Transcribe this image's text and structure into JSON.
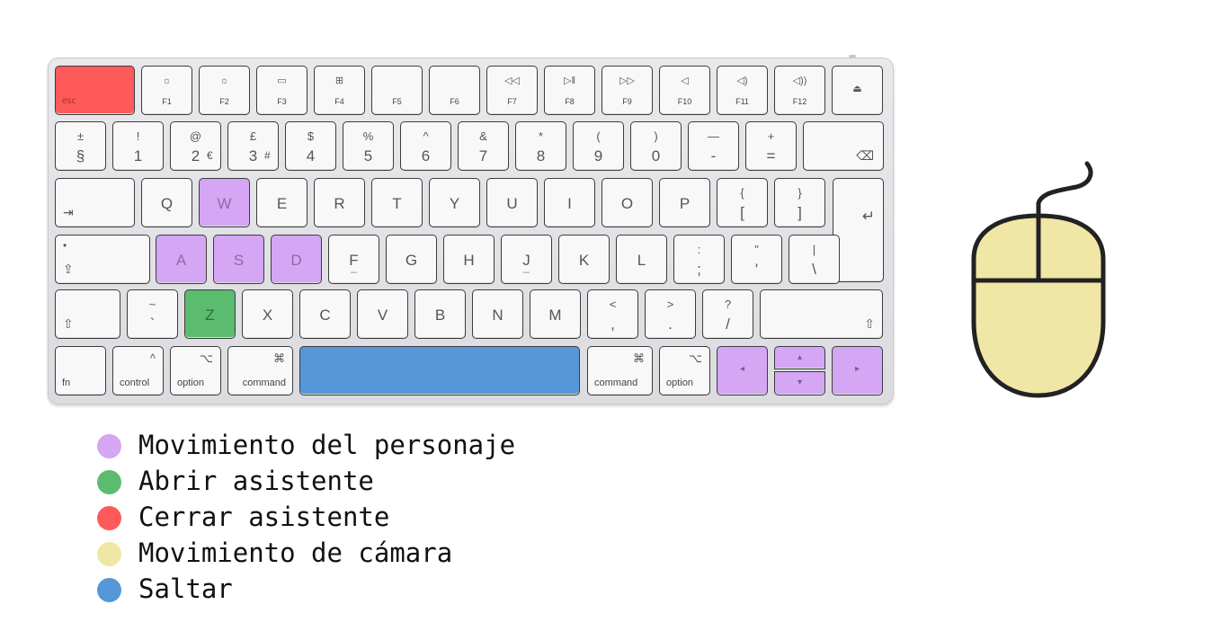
{
  "keyboard": {
    "rows": [
      [
        {
          "id": "esc",
          "main": "esc",
          "highlight": "red"
        },
        {
          "id": "f1",
          "icon": "☼",
          "sub": "F1"
        },
        {
          "id": "f2",
          "icon": "☼",
          "sub": "F2"
        },
        {
          "id": "f3",
          "icon": "▭",
          "sub": "F3"
        },
        {
          "id": "f4",
          "icon": "⊞",
          "sub": "F4"
        },
        {
          "id": "f5",
          "sub": "F5"
        },
        {
          "id": "f6",
          "sub": "F6"
        },
        {
          "id": "f7",
          "icon": "◁◁",
          "sub": "F7"
        },
        {
          "id": "f8",
          "icon": "▷‖",
          "sub": "F8"
        },
        {
          "id": "f9",
          "icon": "▷▷",
          "sub": "F9"
        },
        {
          "id": "f10",
          "icon": "◁",
          "sub": "F10"
        },
        {
          "id": "f11",
          "icon": "◁)",
          "sub": "F11"
        },
        {
          "id": "f12",
          "icon": "◁))",
          "sub": "F12"
        },
        {
          "id": "eject",
          "icon": "⏏"
        }
      ],
      [
        {
          "id": "section",
          "top": "±",
          "bottom": "§"
        },
        {
          "id": "1",
          "top": "!",
          "bottom": "1"
        },
        {
          "id": "2",
          "top": "@",
          "bottom": "2",
          "extra": "€"
        },
        {
          "id": "3",
          "top": "£",
          "bottom": "3",
          "extra": "#"
        },
        {
          "id": "4",
          "top": "$",
          "bottom": "4"
        },
        {
          "id": "5",
          "top": "%",
          "bottom": "5"
        },
        {
          "id": "6",
          "top": "^",
          "bottom": "6"
        },
        {
          "id": "7",
          "top": "&",
          "bottom": "7"
        },
        {
          "id": "8",
          "top": "*",
          "bottom": "8"
        },
        {
          "id": "9",
          "top": "(",
          "bottom": "9"
        },
        {
          "id": "0",
          "top": ")",
          "bottom": "0"
        },
        {
          "id": "minus",
          "top": "—",
          "bottom": "-"
        },
        {
          "id": "plus",
          "top": "+",
          "bottom": "="
        },
        {
          "id": "delete",
          "icon": "⌫"
        }
      ],
      [
        {
          "id": "tab",
          "icon": "⇥"
        },
        {
          "id": "q",
          "main": "Q"
        },
        {
          "id": "w",
          "main": "W",
          "highlight": "purple"
        },
        {
          "id": "e",
          "main": "E"
        },
        {
          "id": "r",
          "main": "R"
        },
        {
          "id": "t",
          "main": "T"
        },
        {
          "id": "y",
          "main": "Y"
        },
        {
          "id": "u",
          "main": "U"
        },
        {
          "id": "i",
          "main": "I"
        },
        {
          "id": "o",
          "main": "O"
        },
        {
          "id": "p",
          "main": "P"
        },
        {
          "id": "bracket-open",
          "top": "{",
          "bottom": "["
        },
        {
          "id": "bracket-close",
          "top": "}",
          "bottom": "]"
        },
        {
          "id": "return",
          "icon": "↵"
        }
      ],
      [
        {
          "id": "caps",
          "icon": "⇪",
          "dot": "•"
        },
        {
          "id": "a",
          "main": "A",
          "highlight": "purple"
        },
        {
          "id": "s",
          "main": "S",
          "highlight": "purple"
        },
        {
          "id": "d",
          "main": "D",
          "highlight": "purple"
        },
        {
          "id": "f",
          "main": "F",
          "bump": "_"
        },
        {
          "id": "g",
          "main": "G"
        },
        {
          "id": "h",
          "main": "H"
        },
        {
          "id": "j",
          "main": "J",
          "bump": "_"
        },
        {
          "id": "k",
          "main": "K"
        },
        {
          "id": "l",
          "main": "L"
        },
        {
          "id": "semicolon",
          "top": ":",
          "bottom": ";"
        },
        {
          "id": "quote",
          "top": "\"",
          "bottom": "'"
        },
        {
          "id": "backslash",
          "top": "|",
          "bottom": "\\"
        }
      ],
      [
        {
          "id": "shift-left",
          "icon": "⇧"
        },
        {
          "id": "tilde",
          "top": "~",
          "bottom": "`"
        },
        {
          "id": "z",
          "main": "Z",
          "highlight": "green"
        },
        {
          "id": "x",
          "main": "X"
        },
        {
          "id": "c",
          "main": "C"
        },
        {
          "id": "v",
          "main": "V"
        },
        {
          "id": "b",
          "main": "B"
        },
        {
          "id": "n",
          "main": "N"
        },
        {
          "id": "m",
          "main": "M"
        },
        {
          "id": "comma",
          "top": "<",
          "bottom": ","
        },
        {
          "id": "period",
          "top": ">",
          "bottom": "."
        },
        {
          "id": "slash",
          "top": "?",
          "bottom": "/"
        },
        {
          "id": "shift-right",
          "icon": "⇧"
        }
      ],
      [
        {
          "id": "fn",
          "label": "fn"
        },
        {
          "id": "control-left",
          "icon": "^",
          "label": "control"
        },
        {
          "id": "option-left",
          "icon": "⌥",
          "label": "option"
        },
        {
          "id": "command-left",
          "icon": "⌘",
          "label": "command"
        },
        {
          "id": "space",
          "highlight": "blue"
        },
        {
          "id": "command-right",
          "icon": "⌘",
          "label": "command"
        },
        {
          "id": "option-right",
          "icon": "⌥",
          "label": "option"
        },
        {
          "id": "arrow-left",
          "icon": "◂",
          "highlight": "purple"
        },
        {
          "id": "arrow-up",
          "icon": "▴",
          "highlight": "purple"
        },
        {
          "id": "arrow-down",
          "icon": "▾",
          "highlight": "purple"
        },
        {
          "id": "arrow-right",
          "icon": "▸",
          "highlight": "purple"
        }
      ]
    ]
  },
  "colors": {
    "purple": "#d4a6f3",
    "green": "#5bbc6f",
    "red": "#ff5a5a",
    "yellow": "#f0e6a6",
    "blue": "#5597d8"
  },
  "mouse": {
    "icon": "mouse-icon",
    "fill": "#f0e6a6"
  },
  "legend": [
    {
      "color": "purple",
      "label": "Movimiento del personaje"
    },
    {
      "color": "green",
      "label": "Abrir asistente"
    },
    {
      "color": "red",
      "label": "Cerrar asistente"
    },
    {
      "color": "yellow",
      "label": "Movimiento de cámara"
    },
    {
      "color": "blue",
      "label": "Saltar"
    }
  ]
}
